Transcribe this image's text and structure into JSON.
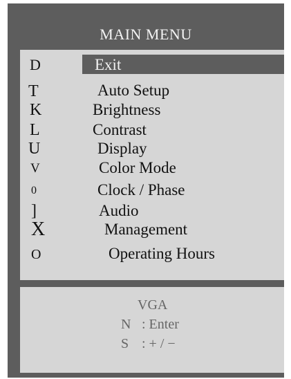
{
  "menu": {
    "title": "MAIN MENU",
    "items": [
      {
        "icon": "D",
        "label": "Exit",
        "selected": true
      },
      {
        "icon": "T",
        "label": "Auto Setup"
      },
      {
        "icon": "K",
        "label": "Brightness"
      },
      {
        "icon": "L",
        "label": "Contrast"
      },
      {
        "icon": "U",
        "label": "Display"
      },
      {
        "icon": "V",
        "label": "Color Mode"
      },
      {
        "icon": "0",
        "label": "Clock / Phase"
      },
      {
        "icon": "]",
        "label": "Audio"
      },
      {
        "icon": "X",
        "label": "Management"
      },
      {
        "icon": "O",
        "label": "Operating Hours"
      }
    ]
  },
  "info": {
    "source": "VGA",
    "enter_key": "N",
    "enter_label": ": Enter",
    "adjust_key": "S",
    "adjust_label": ": + / −"
  },
  "colors": {
    "frame": "#5d5d5d",
    "panel": "#d6d6d6",
    "highlight": "#5d5d5d",
    "title_text": "#f2f2f2"
  }
}
